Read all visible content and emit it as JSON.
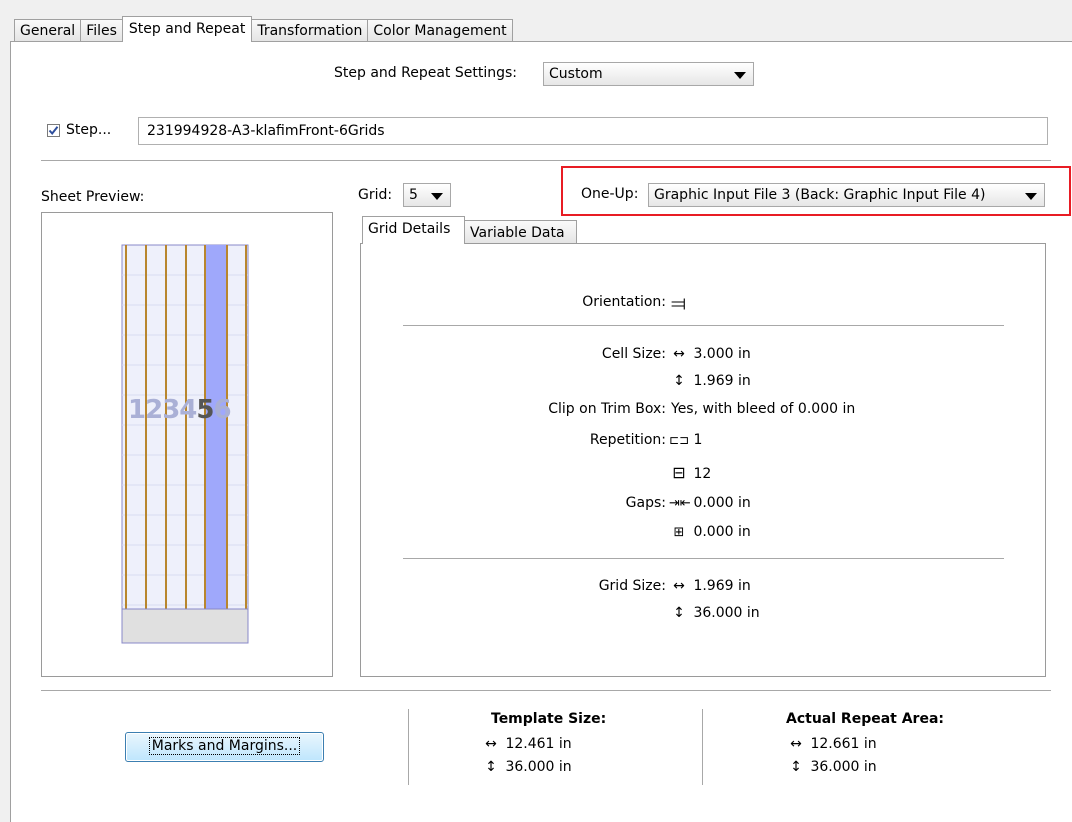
{
  "tabs": [
    {
      "label": "General"
    },
    {
      "label": "Files"
    },
    {
      "label": "Step and Repeat"
    },
    {
      "label": "Transformation"
    },
    {
      "label": "Color Management"
    }
  ],
  "settings": {
    "label": "Step and Repeat Settings:",
    "value": "Custom"
  },
  "step": {
    "label": "Step...",
    "checked": true,
    "value": "231994928-A3-klafimFront-6Grids"
  },
  "sheet_preview": {
    "label": "Sheet Preview:",
    "numbers": "123456",
    "highlighted": "5"
  },
  "grid": {
    "label": "Grid:",
    "value": "5"
  },
  "one_up": {
    "label": "One-Up:",
    "value": "Graphic Input File 3 (Back: Graphic Input File 4)"
  },
  "details_tabs": [
    {
      "label": "Grid Details"
    },
    {
      "label": "Variable Data"
    }
  ],
  "details": {
    "orientation_label": "Orientation:",
    "orientation_icon": "orientation-icon",
    "cell_size_label": "Cell Size:",
    "cell_w": "3.000 in",
    "cell_h": "1.969 in",
    "clip_label": "Clip on Trim Box:",
    "clip_value": "Yes, with bleed of 0.000 in",
    "repetition_label": "Repetition:",
    "rep_h": "1",
    "rep_v": "12",
    "gaps_label": "Gaps:",
    "gap_h": "0.000 in",
    "gap_v": "0.000 in",
    "grid_size_label": "Grid Size:",
    "grid_w": "1.969 in",
    "grid_h": "36.000 in"
  },
  "marks_button": "Marks and Margins...",
  "template": {
    "title": "Template Size:",
    "w": "12.461 in",
    "h": "36.000 in"
  },
  "repeat_area": {
    "title": "Actual Repeat Area:",
    "w": "12.661 in",
    "h": "36.000 in"
  },
  "colors": {
    "highlight_red": "#e81c24",
    "column_blue": "#9fa8fb",
    "column_line": "#b8862e"
  }
}
